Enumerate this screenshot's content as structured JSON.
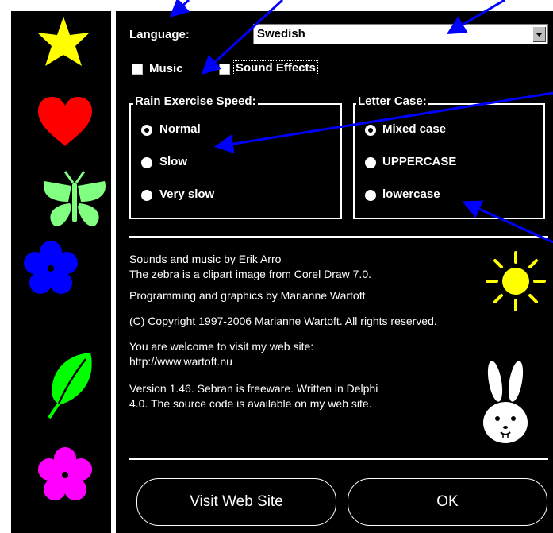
{
  "settings": {
    "language_label": "Language:",
    "language_value": "Swedish",
    "music_label": "Music",
    "music_checked": false,
    "sound_effects_label": "Sound Effects",
    "sound_effects_checked": false
  },
  "rain_speed": {
    "title": "Rain Exercise Speed:",
    "options": [
      "Normal",
      "Slow",
      "Very slow"
    ],
    "selected": "Normal"
  },
  "letter_case": {
    "title": "Letter Case:",
    "options": [
      "Mixed case",
      "UPPERCASE",
      "lowercase"
    ],
    "selected": "Mixed case"
  },
  "about": {
    "line1": "Sounds and music by Erik Arro",
    "line2": "The zebra is a clipart image from Corel Draw 7.0.",
    "line3": "Programming and graphics by Marianne Wartoft",
    "line4": "(C) Copyright 1997-2006 Marianne Wartoft. All rights reserved.",
    "line5": "You are welcome to visit my web site:",
    "line6": "http://www.wartoft.nu",
    "line7": "Version 1.46. Sebran is freeware. Written in Delphi",
    "line8": "4.0. The source code is available on my web site."
  },
  "buttons": {
    "visit": "Visit Web Site",
    "ok": "OK"
  },
  "colors": {
    "background": "#000000",
    "arrows": "#0000ff",
    "star": "#ffff00",
    "heart": "#ff0000",
    "butterfly": "#80ff80",
    "blue_flower": "#0000ff",
    "leaf": "#00ff00",
    "pink_flower": "#ff00ff",
    "sun": "#ffff00"
  },
  "icons": [
    "star-icon",
    "heart-icon",
    "butterfly-icon",
    "blue-flower-icon",
    "leaf-icon",
    "pink-flower-icon",
    "sun-icon",
    "rabbit-icon",
    "dropdown-arrow-icon"
  ]
}
